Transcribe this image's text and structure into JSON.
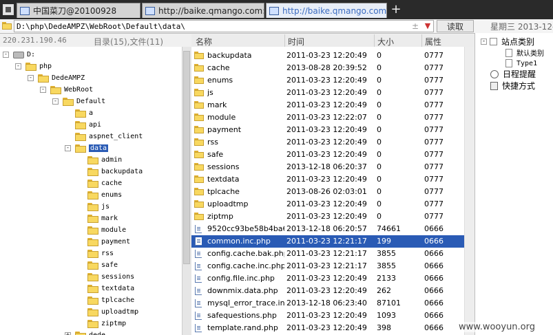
{
  "tabs": [
    {
      "title": "中国菜刀@20100928"
    },
    {
      "title": "http://baike.qmango.com:808..."
    },
    {
      "title": "http://baike.qmango.com:808..."
    }
  ],
  "address": {
    "path": "D:\\php\\DedeAMPZ\\WebRoot\\Default\\data\\",
    "plusminus": "±",
    "read_label": "读取",
    "date": "星期三 2013-12-18"
  },
  "info": {
    "ip": "220.231.190.46",
    "dir_count": "目录(15),文件(11)"
  },
  "tree": [
    {
      "label": "D:",
      "depth": 0,
      "type": "drive",
      "toggle": "-"
    },
    {
      "label": "php",
      "depth": 1,
      "type": "folder",
      "toggle": "-"
    },
    {
      "label": "DedeAMPZ",
      "depth": 2,
      "type": "folder",
      "toggle": "-"
    },
    {
      "label": "WebRoot",
      "depth": 3,
      "type": "folder",
      "toggle": "-"
    },
    {
      "label": "Default",
      "depth": 4,
      "type": "folder",
      "toggle": "-"
    },
    {
      "label": "a",
      "depth": 5,
      "type": "folder",
      "toggle": ""
    },
    {
      "label": "api",
      "depth": 5,
      "type": "folder",
      "toggle": ""
    },
    {
      "label": "aspnet_client",
      "depth": 5,
      "type": "folder",
      "toggle": ""
    },
    {
      "label": "data",
      "depth": 5,
      "type": "folder",
      "toggle": "-",
      "selected": true
    },
    {
      "label": "admin",
      "depth": 6,
      "type": "folder",
      "toggle": ""
    },
    {
      "label": "backupdata",
      "depth": 6,
      "type": "folder",
      "toggle": ""
    },
    {
      "label": "cache",
      "depth": 6,
      "type": "folder",
      "toggle": ""
    },
    {
      "label": "enums",
      "depth": 6,
      "type": "folder",
      "toggle": ""
    },
    {
      "label": "js",
      "depth": 6,
      "type": "folder",
      "toggle": ""
    },
    {
      "label": "mark",
      "depth": 6,
      "type": "folder",
      "toggle": ""
    },
    {
      "label": "module",
      "depth": 6,
      "type": "folder",
      "toggle": ""
    },
    {
      "label": "payment",
      "depth": 6,
      "type": "folder",
      "toggle": ""
    },
    {
      "label": "rss",
      "depth": 6,
      "type": "folder",
      "toggle": ""
    },
    {
      "label": "safe",
      "depth": 6,
      "type": "folder",
      "toggle": ""
    },
    {
      "label": "sessions",
      "depth": 6,
      "type": "folder",
      "toggle": ""
    },
    {
      "label": "textdata",
      "depth": 6,
      "type": "folder",
      "toggle": ""
    },
    {
      "label": "tplcache",
      "depth": 6,
      "type": "folder",
      "toggle": ""
    },
    {
      "label": "uploadtmp",
      "depth": 6,
      "type": "folder",
      "toggle": ""
    },
    {
      "label": "ziptmp",
      "depth": 6,
      "type": "folder",
      "toggle": ""
    },
    {
      "label": "dede",
      "depth": 5,
      "type": "folder",
      "toggle": "+"
    }
  ],
  "columns": {
    "name": "名称",
    "time": "时间",
    "size": "大小",
    "attr": "属性"
  },
  "files": [
    {
      "name": "backupdata",
      "time": "2011-03-23 12:20:49",
      "size": "0",
      "attr": "0777",
      "type": "folder"
    },
    {
      "name": "cache",
      "time": "2013-08-28 20:39:52",
      "size": "0",
      "attr": "0777",
      "type": "folder"
    },
    {
      "name": "enums",
      "time": "2011-03-23 12:20:49",
      "size": "0",
      "attr": "0777",
      "type": "folder"
    },
    {
      "name": "js",
      "time": "2011-03-23 12:20:49",
      "size": "0",
      "attr": "0777",
      "type": "folder"
    },
    {
      "name": "mark",
      "time": "2011-03-23 12:20:49",
      "size": "0",
      "attr": "0777",
      "type": "folder"
    },
    {
      "name": "module",
      "time": "2011-03-23 12:22:07",
      "size": "0",
      "attr": "0777",
      "type": "folder"
    },
    {
      "name": "payment",
      "time": "2011-03-23 12:20:49",
      "size": "0",
      "attr": "0777",
      "type": "folder"
    },
    {
      "name": "rss",
      "time": "2011-03-23 12:20:49",
      "size": "0",
      "attr": "0777",
      "type": "folder"
    },
    {
      "name": "safe",
      "time": "2011-03-23 12:20:49",
      "size": "0",
      "attr": "0777",
      "type": "folder"
    },
    {
      "name": "sessions",
      "time": "2013-12-18 06:20:37",
      "size": "0",
      "attr": "0777",
      "type": "folder"
    },
    {
      "name": "textdata",
      "time": "2011-03-23 12:20:49",
      "size": "0",
      "attr": "0777",
      "type": "folder"
    },
    {
      "name": "tplcache",
      "time": "2013-08-26 02:03:01",
      "size": "0",
      "attr": "0777",
      "type": "folder"
    },
    {
      "name": "uploadtmp",
      "time": "2011-03-23 12:20:49",
      "size": "0",
      "attr": "0777",
      "type": "folder"
    },
    {
      "name": "ziptmp",
      "time": "2011-03-23 12:20:49",
      "size": "0",
      "attr": "0777",
      "type": "folder"
    },
    {
      "name": "9520cc93be58b4ba6...",
      "time": "2013-12-18 06:20:57",
      "size": "74661",
      "attr": "0666",
      "type": "file"
    },
    {
      "name": "common.inc.php",
      "time": "2011-03-23 12:21:17",
      "size": "199",
      "attr": "0666",
      "type": "file",
      "selected": true
    },
    {
      "name": "config.cache.bak.php",
      "time": "2011-03-23 12:21:17",
      "size": "3855",
      "attr": "0666",
      "type": "file"
    },
    {
      "name": "config.cache.inc.php",
      "time": "2011-03-23 12:21:17",
      "size": "3855",
      "attr": "0666",
      "type": "file"
    },
    {
      "name": "config.file.inc.php",
      "time": "2011-03-23 12:20:49",
      "size": "2133",
      "attr": "0666",
      "type": "file"
    },
    {
      "name": "downmix.data.php",
      "time": "2011-03-23 12:20:49",
      "size": "262",
      "attr": "0666",
      "type": "file"
    },
    {
      "name": "mysql_error_trace.inc",
      "time": "2013-12-18 06:23:40",
      "size": "87101",
      "attr": "0666",
      "type": "file"
    },
    {
      "name": "safequestions.php",
      "time": "2011-03-23 12:20:49",
      "size": "1093",
      "attr": "0666",
      "type": "file"
    },
    {
      "name": "template.rand.php",
      "time": "2011-03-23 12:20:49",
      "size": "398",
      "attr": "0666",
      "type": "file"
    }
  ],
  "right_panel": [
    {
      "label": "站点类别",
      "kind": "group",
      "toggle": "-"
    },
    {
      "label": "默认类别",
      "kind": "sub"
    },
    {
      "label": "Type1",
      "kind": "sub"
    },
    {
      "label": "日程提醒",
      "kind": "clock"
    },
    {
      "label": "快捷方式",
      "kind": "book"
    }
  ],
  "watermark": "www.wooyun.org",
  "colors": {
    "selection": "#2a5bb5",
    "folder": "#f8d860",
    "tabbar": "#2a2a2a"
  }
}
